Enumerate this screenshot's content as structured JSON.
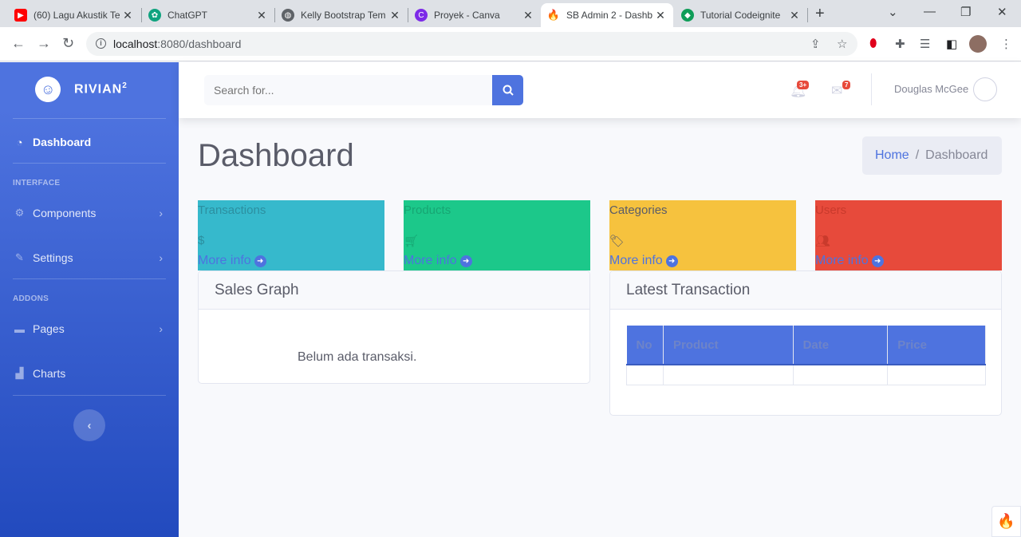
{
  "browser": {
    "tabs": [
      {
        "title": "(60) Lagu Akustik Te",
        "icon": "youtube-icon",
        "color": "#ff0000"
      },
      {
        "title": "ChatGPT",
        "icon": "chatgpt-icon",
        "color": "#10a37f"
      },
      {
        "title": "Kelly Bootstrap Tem",
        "icon": "globe-icon",
        "color": "#5f6368"
      },
      {
        "title": "Proyek - Canva",
        "icon": "canva-icon",
        "color": "#00c4cc"
      },
      {
        "title": "SB Admin 2 - Dashb",
        "icon": "codeigniter-icon",
        "color": "#dd4814"
      },
      {
        "title": "Tutorial Codeignite",
        "icon": "tutorial-icon",
        "color": "#0f9d58"
      }
    ],
    "url_host": "localhost",
    "url_path": ":8080/dashboard"
  },
  "sidebar": {
    "brand": "RIVIAN",
    "brand_sup": "2",
    "dashboard": "Dashboard",
    "heading_interface": "INTERFACE",
    "components": "Components",
    "settings": "Settings",
    "heading_addons": "ADDONS",
    "pages": "Pages",
    "charts": "Charts"
  },
  "topbar": {
    "search_placeholder": "Search for...",
    "alerts_badge": "3+",
    "messages_badge": "7",
    "user_name": "Douglas McGee"
  },
  "main": {
    "title": "Dashboard",
    "breadcrumb_home": "Home",
    "breadcrumb_sep": "/",
    "breadcrumb_current": "Dashboard",
    "stats": [
      {
        "label": "Transactions",
        "icon": "dollar-icon",
        "bg": "#36b9cc",
        "text_color": "#2c8fa0",
        "more": "More info"
      },
      {
        "label": "Products",
        "icon": "cart-icon",
        "bg": "#1cc88a",
        "text_color": "#17a673",
        "more": "More info"
      },
      {
        "label": "Categories",
        "icon": "tags-icon",
        "bg": "#f6c23e",
        "text_color": "#5a5c69",
        "more": "More info"
      },
      {
        "label": "Users",
        "icon": "users-icon",
        "bg": "#e74a3b",
        "text_color": "#c93a2c",
        "more": "More info"
      }
    ],
    "sales_graph_title": "Sales Graph",
    "sales_empty": "Belum ada transaksi.",
    "latest_tx_title": "Latest Transaction",
    "tx_columns": [
      "No",
      "Product",
      "Date",
      "Price"
    ]
  }
}
